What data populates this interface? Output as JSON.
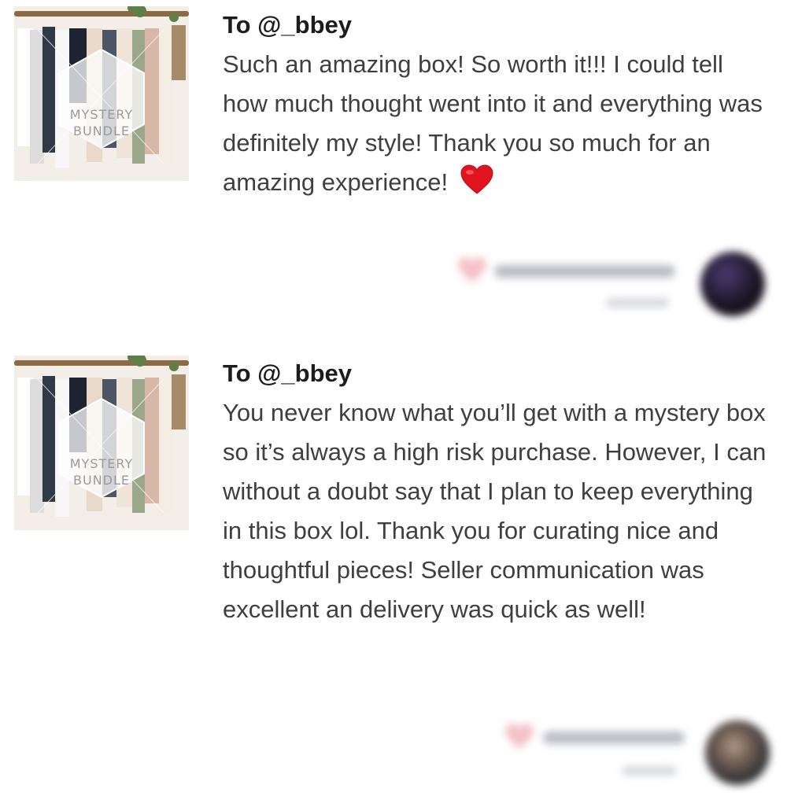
{
  "reviews": [
    {
      "thumbnail": {
        "line1": "MYSTERY",
        "line2": "BUNDLE"
      },
      "to": "To @_bbey",
      "text": "Such an amazing box! So worth it!!! I could tell how much thought went into it and everything was definitely my style! Thank you so much for an amazing experience!",
      "emoji": "red-heart",
      "colors": {
        "heart": "#e0141e",
        "like": "#f3c2c8",
        "avatar": "#1a1524"
      }
    },
    {
      "thumbnail": {
        "line1": "MYSTERY",
        "line2": "BUNDLE"
      },
      "to": "To @_bbey",
      "text": "You never know what you’ll get with a mystery box so it’s always a high risk purchase. However, I can without a doubt say that I plan to keep everything in this box lol. Thank you for curating nice and thoughtful pieces! Seller communication was excellent an delivery was quick as well!",
      "colors": {
        "like": "#f3c2c8",
        "avatar": "#3a3a3e"
      }
    }
  ]
}
